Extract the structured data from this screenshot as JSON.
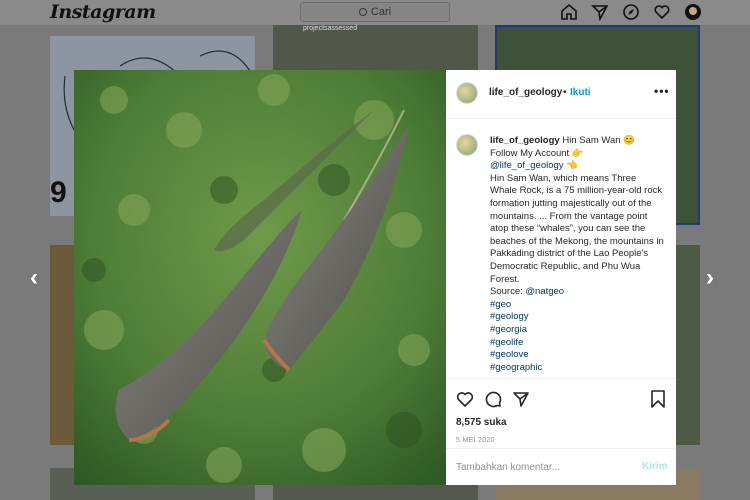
{
  "nav": {
    "logo": "Instagram",
    "search_placeholder": "Cari",
    "icons": [
      "home-icon",
      "direct-icon",
      "explore-icon",
      "heart-icon",
      "profile-avatar"
    ]
  },
  "background": {
    "tile_big_text": "9",
    "tile_label": "projectsassessed"
  },
  "post": {
    "username": "life_of_geology",
    "separator": "•",
    "follow_label": "Ikuti",
    "more_label": "•••",
    "caption": {
      "username": "life_of_geology",
      "lines": [
        "Hin Sam Wan 😊",
        "Follow My Account 👉",
        "@life_of_geology 👈",
        "Hin Sam Wan, which means Three Whale Rock, is a 75 million-year-old rock formation jutting majestically out of the mountains. ... From the vantage point atop these “whales”, you can see the beaches of the Mekong, the mountains in Pakkading district of the Lao People's Democratic Republic, and Phu Wua Forest."
      ],
      "source_label": "Source:",
      "source_handle": "@natgeo",
      "hashtags": [
        "#geo",
        "#geology",
        "#georgia",
        "#geolife",
        "#geolove",
        "#geographic"
      ]
    },
    "likes": "8,575 suka",
    "date": "5 MEI 2020",
    "comment_placeholder": "Tambahkan komentar...",
    "post_label": "Kirim"
  },
  "colors": {
    "link": "#0095f6",
    "mention": "#00376b",
    "post_disabled": "#b2dffc"
  }
}
